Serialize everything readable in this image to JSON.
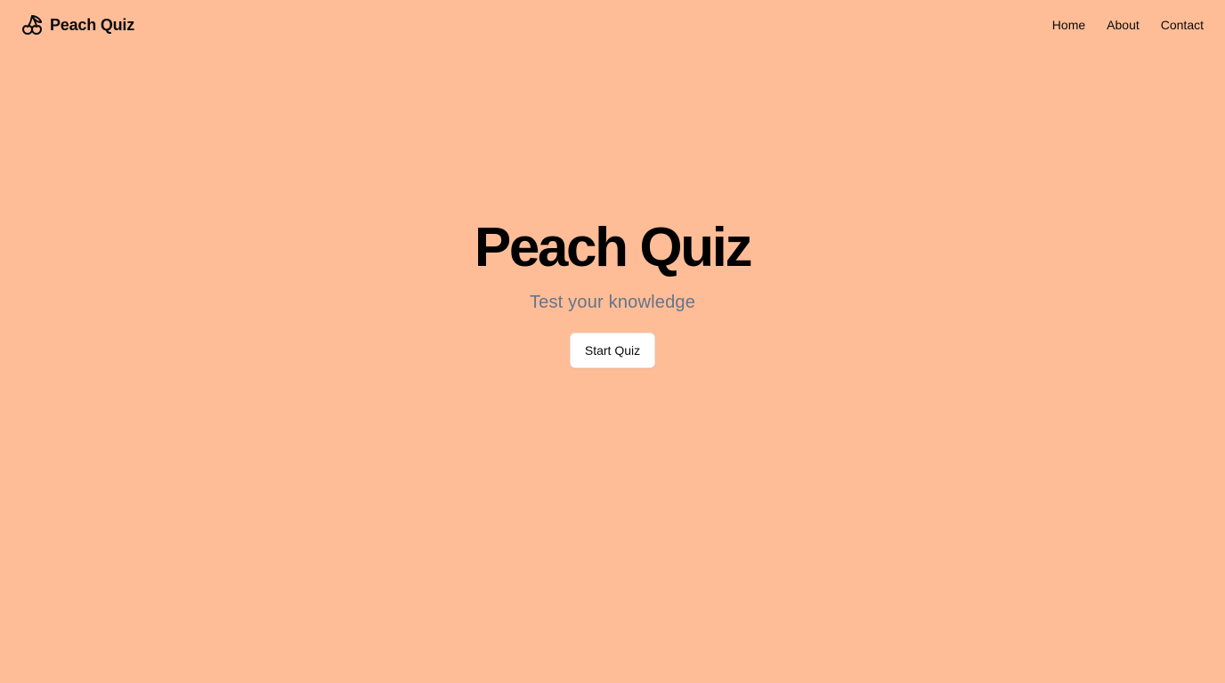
{
  "header": {
    "brand_name": "Peach Quiz",
    "brand_icon": "cherry-icon",
    "nav": {
      "home": "Home",
      "about": "About",
      "contact": "Contact"
    }
  },
  "hero": {
    "title": "Peach Quiz",
    "subtitle": "Test your knowledge",
    "start_button_label": "Start Quiz"
  },
  "colors": {
    "background": "#FFBD97",
    "subtitle": "#64748b",
    "button_bg": "#ffffff"
  }
}
